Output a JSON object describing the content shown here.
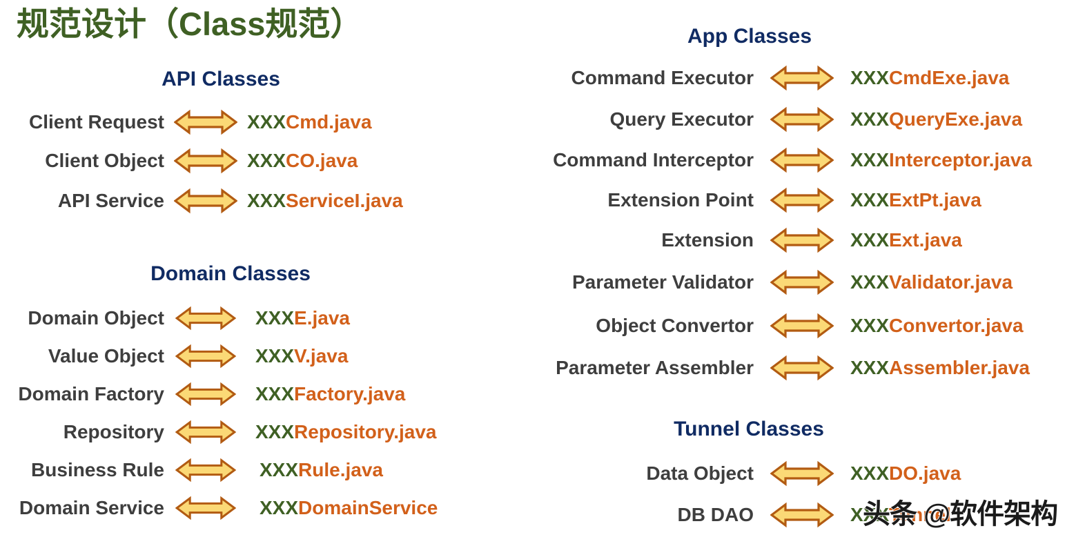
{
  "title": "规范设计（Class规范）",
  "colors": {
    "title_green": "#3F6024",
    "heading_navy": "#102B63",
    "label_gray": "#3E3E3E",
    "class_prefix_green": "#3F6024",
    "class_suffix_orange": "#D2601A",
    "arrow_fill": "#FBD976",
    "arrow_stroke": "#B25B12",
    "background": "#FFFFFF"
  },
  "icons": {
    "arrow": "left-right-arrow-icon"
  },
  "left_column": {
    "sections": [
      {
        "heading": "API Classes",
        "rows": [
          {
            "label": "Client Request",
            "arrow": "left-right-arrow-icon",
            "class_prefix": "XXX",
            "class_suffix": "Cmd.java"
          },
          {
            "label": "Client Object",
            "arrow": "left-right-arrow-icon",
            "class_prefix": "XXX",
            "class_suffix": "CO.java"
          },
          {
            "label": "API Service",
            "arrow": "left-right-arrow-icon",
            "class_prefix": "XXX",
            "class_suffix": "ServiceI.java"
          }
        ]
      },
      {
        "heading": "Domain Classes",
        "rows": [
          {
            "label": "Domain Object",
            "arrow": "left-right-arrow-icon",
            "class_prefix": "XXX",
            "class_suffix": "E.java"
          },
          {
            "label": "Value Object",
            "arrow": "left-right-arrow-icon",
            "class_prefix": "XXX",
            "class_suffix": "V.java"
          },
          {
            "label": "Domain Factory",
            "arrow": "left-right-arrow-icon",
            "class_prefix": "XXX",
            "class_suffix": "Factory.java"
          },
          {
            "label": "Repository",
            "arrow": "left-right-arrow-icon",
            "class_prefix": "XXX",
            "class_suffix": "Repository.java"
          },
          {
            "label": "Business Rule",
            "arrow": "left-right-arrow-icon",
            "class_prefix": "XXX",
            "class_suffix": "Rule.java"
          },
          {
            "label": "Domain Service",
            "arrow": "left-right-arrow-icon",
            "class_prefix": "XXX",
            "class_suffix": "DomainService"
          }
        ]
      }
    ]
  },
  "right_column": {
    "sections": [
      {
        "heading": "App Classes",
        "rows": [
          {
            "label": "Command Executor",
            "arrow": "left-right-arrow-icon",
            "class_prefix": "XXX",
            "class_suffix": "CmdExe.java"
          },
          {
            "label": "Query Executor",
            "arrow": "left-right-arrow-icon",
            "class_prefix": "XXX",
            "class_suffix": "QueryExe.java"
          },
          {
            "label": "Command Interceptor",
            "arrow": "left-right-arrow-icon",
            "class_prefix": "XXX",
            "class_suffix": "Interceptor.java"
          },
          {
            "label": "Extension Point",
            "arrow": "left-right-arrow-icon",
            "class_prefix": "XXX",
            "class_suffix": "ExtPt.java"
          },
          {
            "label": "Extension",
            "arrow": "left-right-arrow-icon",
            "class_prefix": "XXX",
            "class_suffix": "Ext.java"
          },
          {
            "label": "Parameter Validator",
            "arrow": "left-right-arrow-icon",
            "class_prefix": "XXX",
            "class_suffix": "Validator.java"
          },
          {
            "label": "Object Convertor",
            "arrow": "left-right-arrow-icon",
            "class_prefix": "XXX",
            "class_suffix": "Convertor.java"
          },
          {
            "label": "Parameter Assembler",
            "arrow": "left-right-arrow-icon",
            "class_prefix": "XXX",
            "class_suffix": "Assembler.java"
          }
        ]
      },
      {
        "heading": "Tunnel Classes",
        "rows": [
          {
            "label": "Data Object",
            "arrow": "left-right-arrow-icon",
            "class_prefix": "XXX",
            "class_suffix": "DO.java"
          },
          {
            "label": "DB DAO",
            "arrow": "left-right-arrow-icon",
            "class_prefix": "XXX",
            "class_suffix": "Tunnel"
          }
        ]
      }
    ]
  },
  "watermark": {
    "text": "头条 @软件架构"
  }
}
